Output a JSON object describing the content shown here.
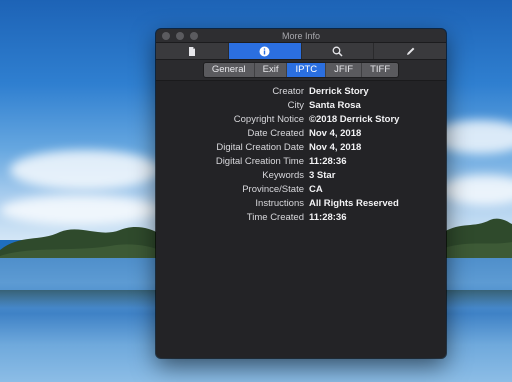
{
  "window": {
    "title": "More Info"
  },
  "toolbar": {
    "tabs": [
      {
        "icon": "document-icon"
      },
      {
        "icon": "info-icon",
        "active": true
      },
      {
        "icon": "search-icon"
      },
      {
        "icon": "pencil-icon"
      }
    ]
  },
  "segments": {
    "tabs": [
      {
        "label": "General"
      },
      {
        "label": "Exif"
      },
      {
        "label": "IPTC",
        "active": true
      },
      {
        "label": "JFIF"
      },
      {
        "label": "TIFF"
      }
    ]
  },
  "iptc": {
    "rows": [
      {
        "key": "Creator",
        "value": "Derrick Story"
      },
      {
        "key": "City",
        "value": "Santa Rosa"
      },
      {
        "key": "Copyright Notice",
        "value": "©2018 Derrick Story"
      },
      {
        "key": "Date Created",
        "value": "Nov 4, 2018"
      },
      {
        "key": "Digital Creation Date",
        "value": "Nov 4, 2018"
      },
      {
        "key": "Digital Creation Time",
        "value": "11:28:36"
      },
      {
        "key": "Keywords",
        "value": "3 Star"
      },
      {
        "key": "Province/State",
        "value": "CA"
      },
      {
        "key": "Instructions",
        "value": "All Rights Reserved"
      },
      {
        "key": "Time Created",
        "value": "11:28:36"
      }
    ]
  },
  "colors": {
    "accent": "#2b6fe0",
    "window_bg": "#232326"
  }
}
